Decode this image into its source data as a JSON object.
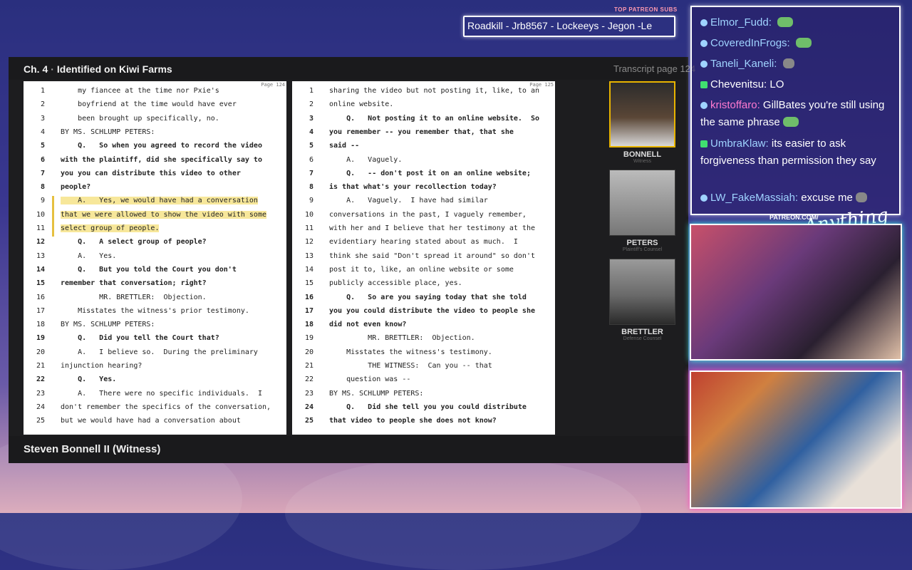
{
  "patreon": {
    "title": "TOP PATREON SUBS",
    "names": "Roadkill - Jrb8567 - Lockeeys - Jegon -Le"
  },
  "viewer": {
    "chapter_num": "Ch. 4",
    "chapter_title": "Identified on Kiwi Farms",
    "transcript_page": "Transcript page 124"
  },
  "left_page": {
    "page_label": "Page 124",
    "lines": [
      {
        "n": "1",
        "t": "    my fiancee at the time nor Pxie's"
      },
      {
        "n": "2",
        "t": "    boyfriend at the time would have ever"
      },
      {
        "n": "3",
        "t": "    been brought up specifically, no."
      },
      {
        "n": "4",
        "t": "BY MS. SCHLUMP PETERS:"
      },
      {
        "n": "5",
        "t": "    Q.   So when you agreed to record the video",
        "b": true
      },
      {
        "n": "6",
        "t": "with the plaintiff, did she specifically say to",
        "b": true
      },
      {
        "n": "7",
        "t": "you you can distribute this video to other",
        "b": true
      },
      {
        "n": "8",
        "t": "people?",
        "b": true
      },
      {
        "n": "9",
        "t": "    A.   Yes, we would have had a conversation",
        "h": true
      },
      {
        "n": "10",
        "t": "that we were allowed to show the video with some",
        "h": true
      },
      {
        "n": "11",
        "t": "select group of people.",
        "h": true
      },
      {
        "n": "12",
        "t": "    Q.   A select group of people?",
        "b": true
      },
      {
        "n": "13",
        "t": "    A.   Yes."
      },
      {
        "n": "14",
        "t": "    Q.   But you told the Court you don't",
        "b": true
      },
      {
        "n": "15",
        "t": "remember that conversation; right?",
        "b": true
      },
      {
        "n": "16",
        "t": "         MR. BRETTLER:  Objection."
      },
      {
        "n": "17",
        "t": "    Misstates the witness's prior testimony."
      },
      {
        "n": "18",
        "t": "BY MS. SCHLUMP PETERS:"
      },
      {
        "n": "19",
        "t": "    Q.   Did you tell the Court that?",
        "b": true
      },
      {
        "n": "20",
        "t": "    A.   I believe so.  During the preliminary"
      },
      {
        "n": "21",
        "t": "injunction hearing?"
      },
      {
        "n": "22",
        "t": "    Q.   Yes.",
        "b": true
      },
      {
        "n": "23",
        "t": "    A.   There were no specific individuals.  I"
      },
      {
        "n": "24",
        "t": "don't remember the specifics of the conversation,"
      },
      {
        "n": "25",
        "t": "but we would have had a conversation about"
      }
    ]
  },
  "right_page": {
    "page_label": "Page 125",
    "lines": [
      {
        "n": "1",
        "t": "sharing the video but not posting it, like, to an"
      },
      {
        "n": "2",
        "t": "online website."
      },
      {
        "n": "3",
        "t": "    Q.   Not posting it to an online website.  So",
        "b": true
      },
      {
        "n": "4",
        "t": "you remember -- you remember that, that she",
        "b": true
      },
      {
        "n": "5",
        "t": "said --",
        "b": true
      },
      {
        "n": "6",
        "t": "    A.   Vaguely."
      },
      {
        "n": "7",
        "t": "    Q.   -- don't post it on an online website;",
        "b": true
      },
      {
        "n": "8",
        "t": "is that what's your recollection today?",
        "b": true
      },
      {
        "n": "9",
        "t": "    A.   Vaguely.  I have had similar"
      },
      {
        "n": "10",
        "t": "conversations in the past, I vaguely remember,"
      },
      {
        "n": "11",
        "t": "with her and I believe that her testimony at the"
      },
      {
        "n": "12",
        "t": "evidentiary hearing stated about as much.  I"
      },
      {
        "n": "13",
        "t": "think she said \"Don't spread it around\" so don't"
      },
      {
        "n": "14",
        "t": "post it to, like, an online website or some"
      },
      {
        "n": "15",
        "t": "publicly accessible place, yes."
      },
      {
        "n": "16",
        "t": "    Q.   So are you saying today that she told",
        "b": true
      },
      {
        "n": "17",
        "t": "you you could distribute the video to people she",
        "b": true
      },
      {
        "n": "18",
        "t": "did not even know?",
        "b": true
      },
      {
        "n": "19",
        "t": "         MR. BRETTLER:  Objection."
      },
      {
        "n": "20",
        "t": "    Misstates the witness's testimony."
      },
      {
        "n": "21",
        "t": "         THE WITNESS:  Can you -- that"
      },
      {
        "n": "22",
        "t": "    question was --"
      },
      {
        "n": "23",
        "t": "BY MS. SCHLUMP PETERS:"
      },
      {
        "n": "24",
        "t": "    Q.   Did she tell you you could distribute",
        "b": true
      },
      {
        "n": "25",
        "t": "that video to people she does not know?",
        "b": true
      }
    ]
  },
  "witnesses": [
    {
      "name": "BONNELL",
      "role": "Witness"
    },
    {
      "name": "PETERS",
      "role": "Plaintiff's Counsel"
    },
    {
      "name": "BRETTLER",
      "role": "Defense Counsel"
    }
  ],
  "current_witness": "Steven Bonnell II (Witness)",
  "chat": [
    {
      "user": "Elmor_Fudd:",
      "text": "",
      "color": "#9fd3ff",
      "badge": "blue",
      "emote": "green"
    },
    {
      "user": "CoveredInFrogs:",
      "text": "",
      "color": "#9fd3ff",
      "badge": "blue",
      "emote": "green"
    },
    {
      "user": "Taneli_Kaneli:",
      "text": "",
      "color": "#9fd3ff",
      "badge": "blue",
      "emote": "gray"
    },
    {
      "user": "Chevenitsu:",
      "text": "LO",
      "color": "#ffffff",
      "badge": "green",
      "emote": ""
    },
    {
      "user": "kristoffaro:",
      "text": "GillBates you're still using the same phrase",
      "color": "#ff7ad0",
      "badge": "blue",
      "emote": "green"
    },
    {
      "user": "UmbraKlaw:",
      "text": "its easier to ask forgiveness than permission they say",
      "color": "#9fd3ff",
      "badge": "green",
      "emote": ""
    },
    {
      "user": "LW_FakeMassiah:",
      "text": "excuse me",
      "color": "#9fd3ff",
      "badge": "blue",
      "emote": "gray"
    }
  ],
  "patreon_sig": {
    "url": "PATREON.COM/",
    "script": "Anything Else"
  }
}
